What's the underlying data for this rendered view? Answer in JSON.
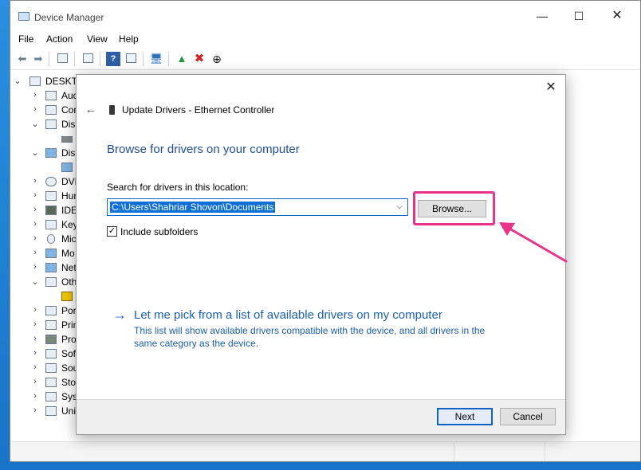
{
  "window": {
    "title": "Device Manager",
    "controls": {
      "minimize": "—",
      "maximize": "☐",
      "close": "✕"
    }
  },
  "menu": [
    "File",
    "Action",
    "View",
    "Help"
  ],
  "toolbar": {
    "icons": [
      "back-icon",
      "forward-icon",
      "properties-icon",
      "list-icon",
      "help-icon",
      "view-icon",
      "scan-icon",
      "update-driver-icon",
      "uninstall-icon",
      "disable-icon"
    ],
    "uninstall_color": "#d81e1e",
    "update_color": "#1f9a35"
  },
  "tree": {
    "root": "DESKTO",
    "items": [
      {
        "label": "Aud",
        "expanded": false
      },
      {
        "label": "Cor",
        "expanded": false
      },
      {
        "label": "Disk",
        "expanded": true
      },
      {
        "label": "Disp",
        "expanded": true
      },
      {
        "label": "DVD",
        "expanded": false
      },
      {
        "label": "Hur",
        "expanded": false
      },
      {
        "label": "IDE",
        "expanded": false
      },
      {
        "label": "Key",
        "expanded": false
      },
      {
        "label": "Mic",
        "expanded": false
      },
      {
        "label": "Mo",
        "expanded": false
      },
      {
        "label": "Net",
        "expanded": false
      },
      {
        "label": "Oth",
        "expanded": true
      },
      {
        "label": "Por",
        "expanded": false
      },
      {
        "label": "Prin",
        "expanded": false
      },
      {
        "label": "Pro",
        "expanded": false
      },
      {
        "label": "Sof",
        "expanded": false
      },
      {
        "label": "Sou",
        "expanded": false
      },
      {
        "label": "Sto",
        "expanded": false
      },
      {
        "label": "Sys",
        "expanded": false
      },
      {
        "label": "Uni",
        "expanded": false
      }
    ]
  },
  "dialog": {
    "header": "Update Drivers - Ethernet Controller",
    "heading": "Browse for drivers on your computer",
    "search_label": "Search for drivers in this location:",
    "path_value": "C:\\Users\\Shahriar Shovon\\Documents",
    "browse_label": "Browse...",
    "include_subfolders_label": "Include subfolders",
    "include_subfolders_checked": true,
    "pick_link": "Let me pick from a list of available drivers on my computer",
    "pick_description": "This list will show available drivers compatible with the device, and all drivers in the same category as the device.",
    "next_label": "Next",
    "cancel_label": "Cancel",
    "close_glyph": "✕",
    "back_glyph": "←",
    "pick_arrow_glyph": "→"
  },
  "highlight_color": "#e9338a"
}
